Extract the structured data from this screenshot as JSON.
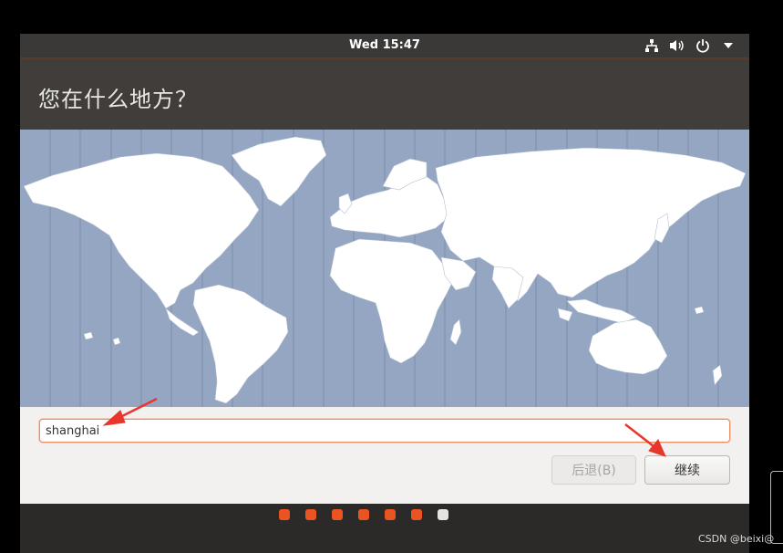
{
  "topbar": {
    "clock": "Wed 15:47",
    "icons": [
      "network-icon",
      "volume-icon",
      "power-icon",
      "chevron-down-icon"
    ]
  },
  "header": {
    "title": "您在什么地方？"
  },
  "location": {
    "value": "shanghai"
  },
  "buttons": {
    "back_label": "后退(B)",
    "continue_label": "继续"
  },
  "progress": {
    "total_steps": 7,
    "current_step": 7
  },
  "watermark": "CSDN @beixi@",
  "colors": {
    "accent": "#e95420",
    "map_ocean": "#94a6c2",
    "land": "#ffffff",
    "header_bg": "#403d3a",
    "annotation_arrow": "#e8362c"
  }
}
